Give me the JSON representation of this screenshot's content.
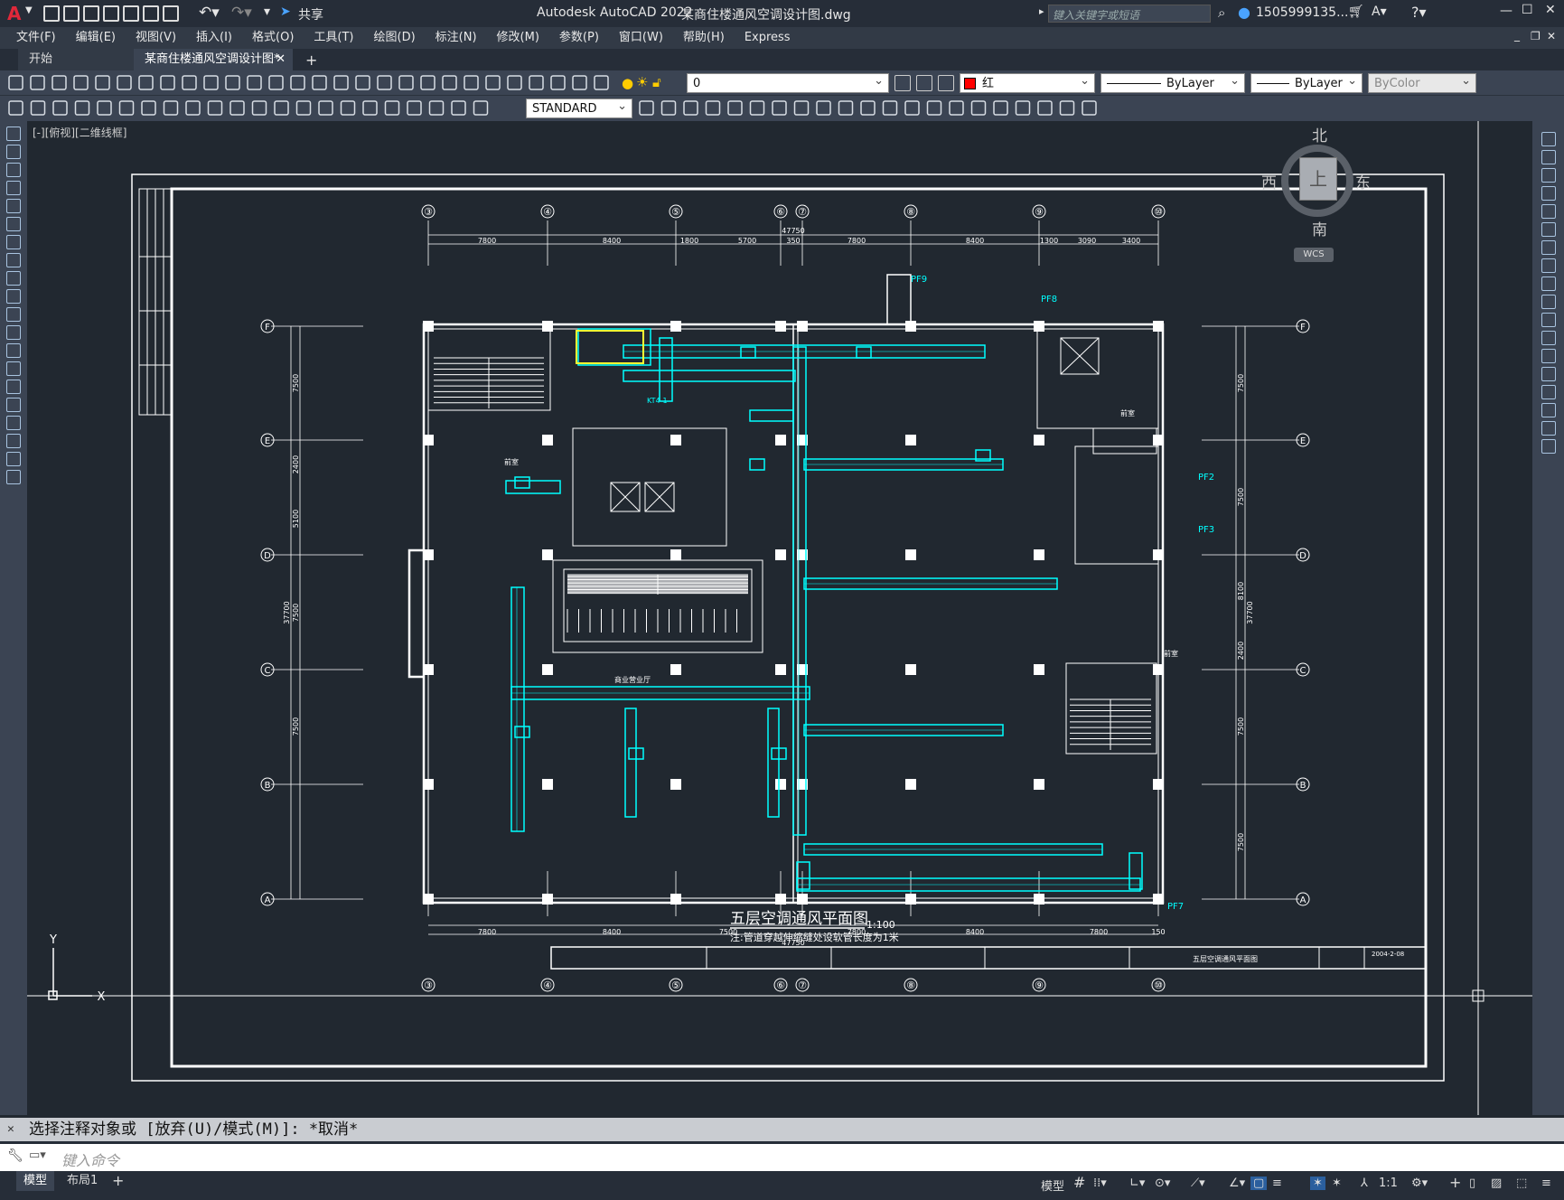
{
  "window": {
    "title": "Autodesk AutoCAD 2022",
    "filename": "某商住楼通风空调设计图.dwg",
    "share_label": "共享",
    "search_placeholder": "键入关键字或短语",
    "user": "1505999135..."
  },
  "menu": [
    "文件(F)",
    "编辑(E)",
    "视图(V)",
    "插入(I)",
    "格式(O)",
    "工具(T)",
    "绘图(D)",
    "标注(N)",
    "修改(M)",
    "参数(P)",
    "窗口(W)",
    "帮助(H)",
    "Express"
  ],
  "tabs": {
    "start": "开始",
    "doc": "某商住楼通风空调设计图*"
  },
  "toolbar": {
    "layer_value": "0",
    "color_value": "红",
    "linetype_value": "ByLayer",
    "lineweight_value": "ByLayer",
    "plotstyle_value": "ByColor",
    "textstyle_value": "STANDARD"
  },
  "viewport": {
    "label": "[-][俯视][二维线框]",
    "compass": {
      "north": "北",
      "south": "南",
      "east": "东",
      "west": "西",
      "top": "上"
    },
    "wcs": "WCS"
  },
  "drawing": {
    "title": "五层空调通风平面图",
    "scale": "1:100",
    "note": "注:管道穿越伸缩缝处设软管长度为1米",
    "grid_cols": [
      "③",
      "④",
      "⑤",
      "⑥",
      "⑦",
      "⑧",
      "⑨",
      "⑩"
    ],
    "grid_rows": [
      "F",
      "E",
      "D",
      "C",
      "B",
      "A"
    ],
    "top_dims": [
      "7800",
      "8400",
      "1800",
      "5700",
      "350",
      "7800",
      "8400",
      "1300",
      "3090",
      "3400"
    ],
    "total_dim": "47750",
    "bottom_dims": [
      "7800",
      "8400",
      "7500",
      "7800",
      "8400",
      "7800",
      "150"
    ],
    "left_dims": [
      "7500",
      "2400",
      "5100",
      "7500",
      "7500"
    ],
    "left_total": "37700",
    "right_dims": [
      "7500",
      "7500",
      "8100",
      "2400",
      "7500",
      "7500"
    ],
    "right_total": "37700",
    "labels": [
      "PF9",
      "PF8",
      "PF2",
      "PF3",
      "PF7",
      "KT4-1",
      "商业营业厅",
      "前室",
      "前室",
      "前室"
    ],
    "title_block": "五层空调通风平面图",
    "date": "2004-2-08"
  },
  "command": {
    "history": "选择注释对象或 [放弃(U)/模式(M)]: *取消*",
    "placeholder": "键入命令"
  },
  "status": {
    "model_tab": "模型",
    "layout_tab": "布局1",
    "model_label": "模型",
    "scale": "1:1"
  }
}
